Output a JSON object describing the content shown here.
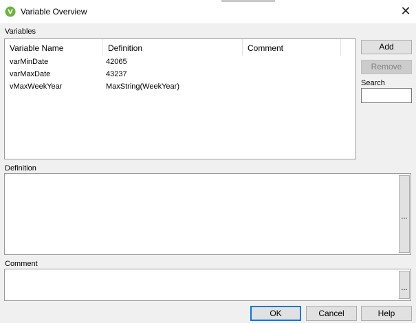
{
  "window": {
    "title": "Variable Overview",
    "close_glyph": "✕",
    "app_icon": "qlikview-icon"
  },
  "variables": {
    "label": "Variables",
    "columns": [
      "Variable Name",
      "Definition",
      "Comment"
    ],
    "rows": [
      {
        "name": "varMinDate",
        "definition": "42065",
        "comment": ""
      },
      {
        "name": "varMaxDate",
        "definition": "43237",
        "comment": ""
      },
      {
        "name": "vMaxWeekYear",
        "definition": "MaxString(WeekYear)",
        "comment": ""
      }
    ]
  },
  "side": {
    "add_label": "Add",
    "remove_label": "Remove",
    "search_label": "Search",
    "search_value": ""
  },
  "definition": {
    "label": "Definition",
    "value": "",
    "ellipsis": "..."
  },
  "comment": {
    "label": "Comment",
    "value": "",
    "ellipsis": "..."
  },
  "footer": {
    "ok_label": "OK",
    "cancel_label": "Cancel",
    "help_label": "Help"
  },
  "colors": {
    "accent": "#0078d7",
    "qlik_green": "#6cb33f",
    "dialog_bg": "#f0f0f0"
  }
}
